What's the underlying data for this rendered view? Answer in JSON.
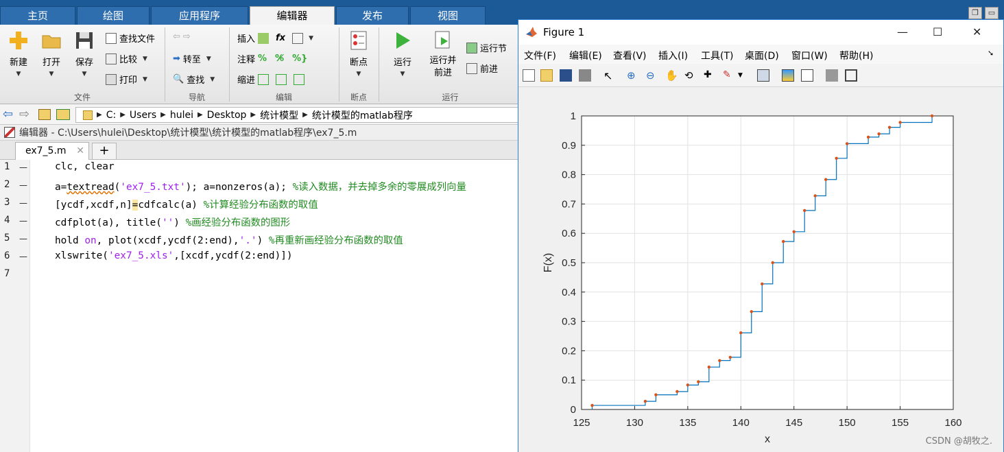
{
  "tabs": [
    "主页",
    "绘图",
    "应用程序",
    "编辑器",
    "发布",
    "视图"
  ],
  "active_tab": "编辑器",
  "toolstrip": {
    "file": {
      "new": "新建",
      "open": "打开",
      "save": "保存",
      "find_files": "查找文件",
      "compare": "比较",
      "print": "打印",
      "group": "文件"
    },
    "nav": {
      "goto": "转至",
      "find": "查找",
      "group": "导航"
    },
    "edit": {
      "insert": "插入",
      "comment": "注释",
      "indent": "缩进",
      "fx": "fx",
      "group": "编辑"
    },
    "breakpoints": {
      "label": "断点",
      "group": "断点"
    },
    "run": {
      "run": "运行",
      "run_advance": "运行并前进",
      "run_section": "运行节",
      "advance": "前进",
      "group": "运行"
    }
  },
  "address": {
    "crumbs": [
      "C:",
      "Users",
      "hulei",
      "Desktop",
      "统计模型",
      "统计模型的matlab程序"
    ]
  },
  "editor": {
    "title": "编辑器 - C:\\Users\\hulei\\Desktop\\统计模型\\统计模型的matlab程序\\ex7_5.m",
    "file_tab": "ex7_5.m",
    "add_tab": "+",
    "close_x": "✕",
    "line_numbers": [
      "1",
      "2",
      "3",
      "4",
      "5",
      "6",
      "7"
    ],
    "lines": [
      [
        {
          "t": "clc, clear",
          "c": ""
        }
      ],
      [
        {
          "t": "a=",
          "c": ""
        },
        {
          "t": "textread",
          "c": "squig"
        },
        {
          "t": "(",
          "c": ""
        },
        {
          "t": "'ex7_5.txt'",
          "c": "str"
        },
        {
          "t": "); a=nonzeros(a); ",
          "c": ""
        },
        {
          "t": "%读入数据，并去掉多余的零展成列向量",
          "c": "cm"
        }
      ],
      [
        {
          "t": "[ycdf,xcdf,n]",
          "c": ""
        },
        {
          "t": "=",
          "c": "hl"
        },
        {
          "t": "cdfcalc(a) ",
          "c": ""
        },
        {
          "t": "%计算经验分布函数的取值",
          "c": "cm"
        }
      ],
      [
        {
          "t": "cdfplot(a), title(",
          "c": ""
        },
        {
          "t": "''",
          "c": "str"
        },
        {
          "t": ") ",
          "c": ""
        },
        {
          "t": "%画经验分布函数的图形",
          "c": "cm"
        }
      ],
      [
        {
          "t": "hold ",
          "c": ""
        },
        {
          "t": "on",
          "c": "str"
        },
        {
          "t": ", plot(xcdf,ycdf(2:end),",
          "c": ""
        },
        {
          "t": "'.'",
          "c": "str"
        },
        {
          "t": ") ",
          "c": ""
        },
        {
          "t": "%再重新画经验分布函数的取值",
          "c": "cm"
        }
      ],
      [
        {
          "t": "xlswrite(",
          "c": ""
        },
        {
          "t": "'ex7_5.xls'",
          "c": "str"
        },
        {
          "t": ",[xcdf,ycdf(2:end)])",
          "c": ""
        }
      ],
      []
    ]
  },
  "figure": {
    "title": "Figure 1",
    "menus": [
      "文件(F)",
      "编辑(E)",
      "查看(V)",
      "插入(I)",
      "工具(T)",
      "桌面(D)",
      "窗口(W)",
      "帮助(H)"
    ],
    "watermark": "CSDN @胡牧之."
  },
  "colors": {
    "accent": "#1c5a97",
    "line": "#0072bd",
    "dots": "#d95319",
    "str": "#a020f0",
    "comment": "#228b22"
  },
  "chart_data": {
    "type": "line",
    "title": "",
    "xlabel": "x",
    "ylabel": "F(x)",
    "xlim": [
      125,
      160
    ],
    "ylim": [
      0,
      1
    ],
    "xticks": [
      125,
      130,
      135,
      140,
      145,
      150,
      155,
      160
    ],
    "yticks": [
      0,
      0.1,
      0.2,
      0.3,
      0.4,
      0.5,
      0.6,
      0.7,
      0.8,
      0.9,
      1
    ],
    "grid": true,
    "series": [
      {
        "style": "stairs",
        "x": [
          126,
          131,
          132,
          134,
          135,
          136,
          137,
          138,
          139,
          140,
          141,
          142,
          143,
          144,
          145,
          146,
          147,
          148,
          149,
          150,
          152,
          153,
          154,
          155,
          158
        ],
        "y": [
          0.0139,
          0.0278,
          0.05,
          0.0611,
          0.0833,
          0.0944,
          0.1444,
          0.1667,
          0.1778,
          0.2611,
          0.3333,
          0.4278,
          0.5,
          0.5722,
          0.6056,
          0.6778,
          0.7278,
          0.7833,
          0.8556,
          0.9056,
          0.9278,
          0.9389,
          0.9611,
          0.9778,
          1.0
        ]
      },
      {
        "style": "dots",
        "x": [
          126,
          131,
          132,
          134,
          135,
          136,
          137,
          138,
          139,
          140,
          141,
          142,
          143,
          144,
          145,
          146,
          147,
          148,
          149,
          150,
          152,
          153,
          154,
          155,
          158
        ],
        "y": [
          0.0139,
          0.0278,
          0.05,
          0.0611,
          0.0833,
          0.0944,
          0.1444,
          0.1667,
          0.1778,
          0.2611,
          0.3333,
          0.4278,
          0.5,
          0.5722,
          0.6056,
          0.6778,
          0.7278,
          0.7833,
          0.8556,
          0.9056,
          0.9278,
          0.9389,
          0.9611,
          0.9778,
          1.0
        ]
      }
    ]
  }
}
